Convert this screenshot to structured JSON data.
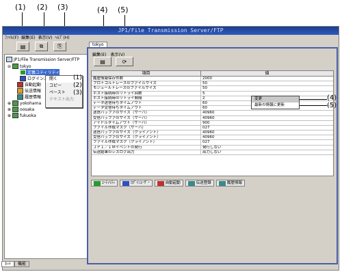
{
  "callouts": [
    "(1)",
    "(2)",
    "(3)",
    "(4)",
    "(5)"
  ],
  "window": {
    "title": "JP1/File Transmission Server/FTP"
  },
  "menu": [
    "ﾌｧｲﾙ(F)",
    "編集(E)",
    "表示(V)",
    "ﾍﾙﾌﾟ(H)"
  ],
  "tree": {
    "root": "JP1/File Transmission Server/FTP",
    "host1": "tokyo",
    "items": [
      "定義ユティリティ",
      "ログインユー",
      "自動起動",
      "伝送情報",
      "履歴情報"
    ],
    "host2": "yokohama",
    "host3": "oosaka",
    "host4": "fukuoka"
  },
  "context_menu": {
    "items": [
      "開く",
      "コピー",
      "ペースト",
      "テキスト出力"
    ],
    "marks": [
      "(1)",
      "(2)",
      "(3)"
    ]
  },
  "left_tabs": [
    "ﾈｯﾄ",
    "機能"
  ],
  "right_tab": "tokyo",
  "right_menu": [
    "編集(E)",
    "表示(V)"
  ],
  "table": {
    "headers": [
      "項目",
      "値"
    ],
    "rows": [
      [
        "履歴情報保存件数",
        "2000"
      ],
      [
        "プロトコルトレースのファイルサイズ",
        "50"
      ],
      [
        "モジュールトレースのファイルサイズ",
        "50"
      ],
      [
        "ホスト接続時のリトライ回数",
        "5"
      ],
      [
        "ホスト接続時のリトライ間隔",
        "2"
      ],
      [
        "データ送信待ちタイムアウト",
        "60"
      ],
      [
        "データ受信待ちタイムアウト",
        "60"
      ],
      [
        "送信バッファのサイズ（サーバ）",
        "40960"
      ],
      [
        "受信バッファのサイズ（サーバ）",
        "40960"
      ],
      [
        "アイドルタイムアウト（サーバ）",
        "900"
      ],
      [
        "ファイル作成マスク（サーバ）",
        "027"
      ],
      [
        "送信バッファのサイズ（クライアント）",
        "40960"
      ],
      [
        "受信バッファのサイズ（クライアント）",
        "40960"
      ],
      [
        "ファイル作成マスク（クライアント）",
        "027"
      ],
      [
        "ＪＰ１／ＩＭイベントの発行",
        "発行しない"
      ],
      [
        "伝送結果のシスログ出力",
        "出力しない"
      ]
    ]
  },
  "context_menu2": {
    "items": [
      "変更",
      "最新の情報に更新"
    ],
    "marks": [
      "(4)",
      "(5)"
    ]
  },
  "bottom_tabs": [
    "ﾕｰﾃｨﾘﾃｨ",
    "ﾛｸﾞｲﾝﾕｰｻﾞｰ",
    "自動起動",
    "伝送登録",
    "履歴情報"
  ],
  "colors": {
    "title_bg": "#2f5bbf",
    "panel_border": "#4a5ea8"
  }
}
